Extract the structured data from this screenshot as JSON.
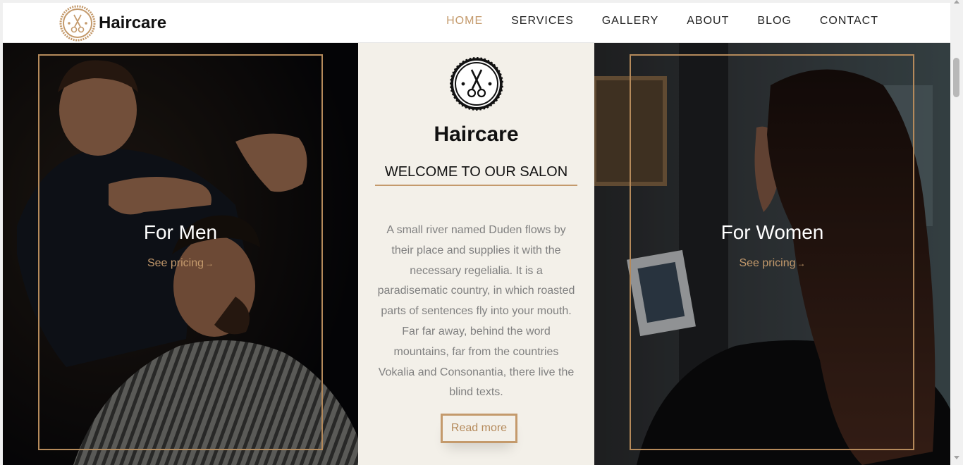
{
  "brand": {
    "name": "Haircare",
    "accent_color": "#c49a6c",
    "logo_icon": "scissors-badge-icon"
  },
  "nav": {
    "items": [
      {
        "label": "HOME",
        "active": true
      },
      {
        "label": "SERVICES",
        "active": false
      },
      {
        "label": "GALLERY",
        "active": false
      },
      {
        "label": "ABOUT",
        "active": false
      },
      {
        "label": "BLOG",
        "active": false
      },
      {
        "label": "CONTACT",
        "active": false
      }
    ]
  },
  "left_panel": {
    "title": "For Men",
    "link_label": "See pricing",
    "link_icon": "arrow-right-icon"
  },
  "center_panel": {
    "logo_icon": "scissors-badge-icon",
    "title": "Haircare",
    "subtitle": "WELCOME TO OUR SALON",
    "text": "A small river named Duden flows by their place and supplies it with the necessary regelialia. It is a paradisematic country, in which roasted parts of sentences fly into your mouth. Far far away, behind the word mountains, far from the countries Vokalia and Consonantia, there live the blind texts.",
    "button_label": "Read more"
  },
  "right_panel": {
    "title": "For Women",
    "link_label": "See pricing",
    "link_icon": "arrow-right-icon"
  }
}
